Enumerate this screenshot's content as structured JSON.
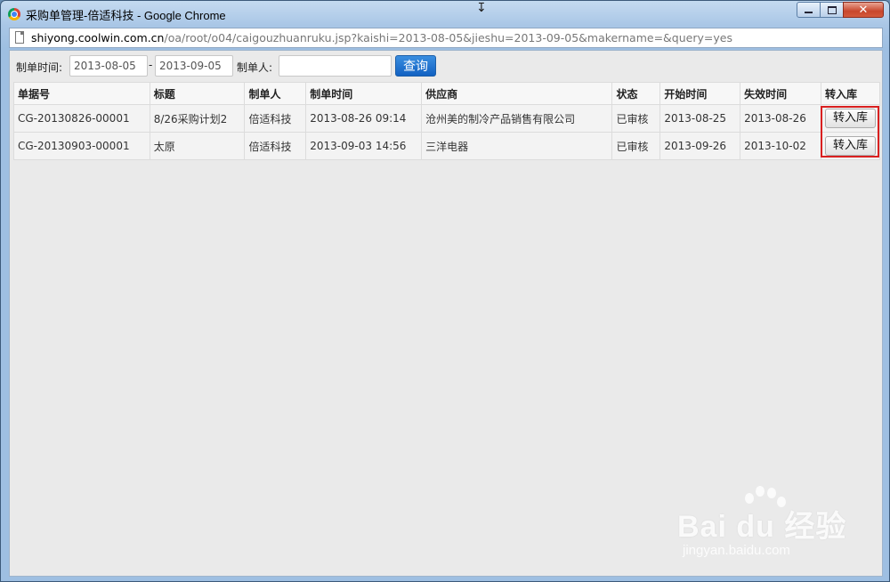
{
  "window": {
    "title": "采购单管理-倍适科技 - Google Chrome",
    "min_glyph": "",
    "max_glyph": "",
    "close_glyph": "✕"
  },
  "address": {
    "host": "shiyong.coolwin.com.cn",
    "path": "/oa/root/o04/caigouzhuanruku.jsp?kaishi=2013-08-05&jieshu=2013-09-05&makername=&query=yes"
  },
  "search": {
    "date_label": "制单时间:",
    "start_date": "2013-08-05",
    "separator": "-",
    "end_date": "2013-09-05",
    "maker_label": "制单人:",
    "maker_value": "",
    "query_label": "查询"
  },
  "table": {
    "headers": [
      "单据号",
      "标题",
      "制单人",
      "制单时间",
      "供应商",
      "状态",
      "开始时间",
      "失效时间",
      "转入库"
    ],
    "rows": [
      {
        "id": "CG-20130826-00001",
        "title": "8/26采购计划2",
        "maker": "倍适科技",
        "made_time": "2013-08-26 09:14",
        "supplier": "沧州美的制冷产品销售有限公司",
        "status": "已审核",
        "start": "2013-08-25",
        "expire": "2013-08-26",
        "action": "转入库"
      },
      {
        "id": "CG-20130903-00001",
        "title": "太原",
        "maker": "倍适科技",
        "made_time": "2013-09-03 14:56",
        "supplier": "三洋电器",
        "status": "已审核",
        "start": "2013-09-26",
        "expire": "2013-10-02",
        "action": "转入库"
      }
    ]
  },
  "watermark": {
    "main": "Bai du 经验",
    "sub": "jingyan.baidu.com"
  },
  "colors": {
    "highlight_box": "#d92020",
    "query_button": "#1161c2"
  }
}
